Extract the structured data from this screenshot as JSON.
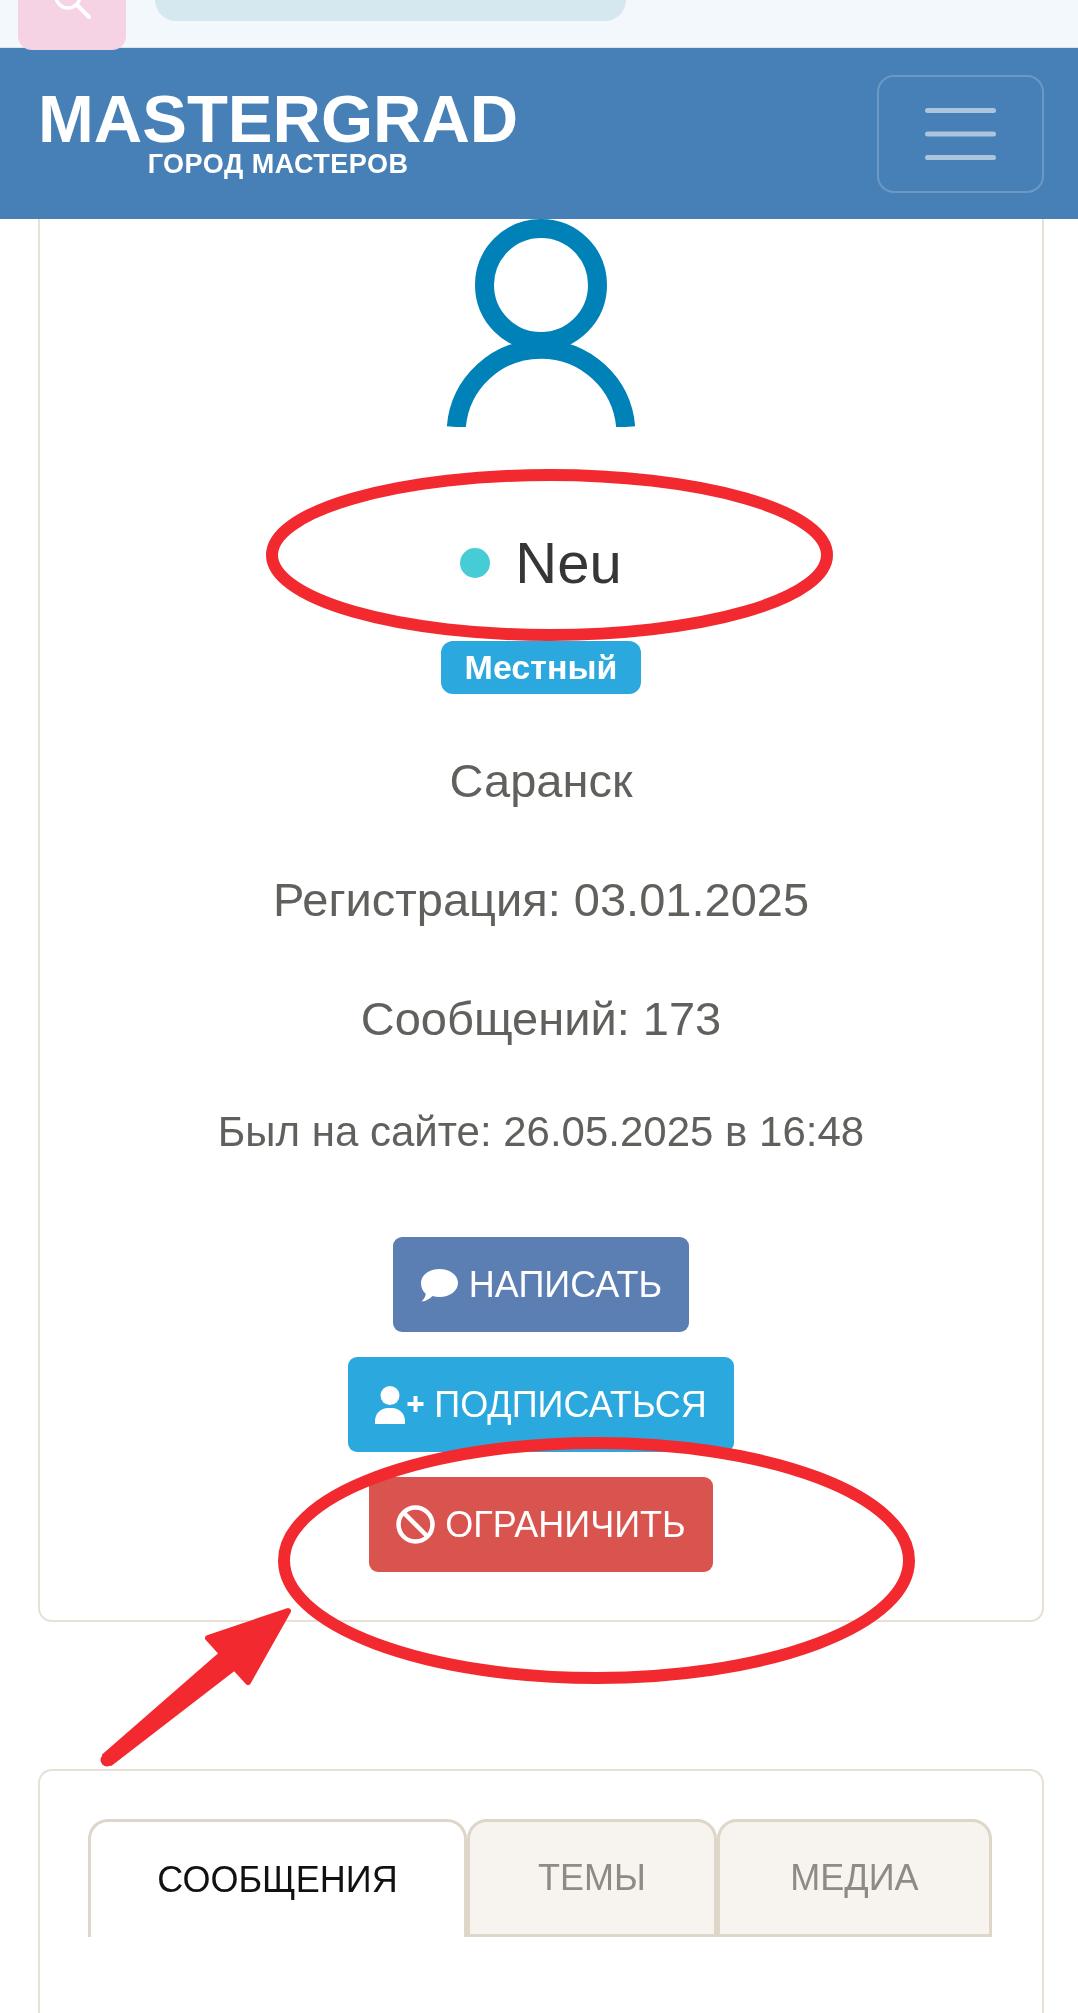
{
  "header": {
    "logo": {
      "title": "MASTERGRAD",
      "subtitle": "ГОРОД МАСТЕРОВ"
    }
  },
  "profile": {
    "name": "Neu",
    "badge": "Местный",
    "city": "Саранск",
    "stats": [
      "Регистрация: 03.01.2025",
      "Сообщений: 173"
    ],
    "last_seen": "Был на сайте: 26.05.2025 в 16:48"
  },
  "actions": [
    {
      "kind": "message",
      "label": "НАПИСАТЬ"
    },
    {
      "kind": "subscribe",
      "label": "ПОДПИСАТЬСЯ"
    },
    {
      "kind": "restrict",
      "label": "ОГРАНИЧИТЬ"
    }
  ],
  "tabs": [
    {
      "label": "СООБЩЕНИЯ",
      "selected": true
    },
    {
      "label": "ТЕМЫ",
      "selected": false
    },
    {
      "label": "МЕДИА",
      "selected": false
    }
  ]
}
